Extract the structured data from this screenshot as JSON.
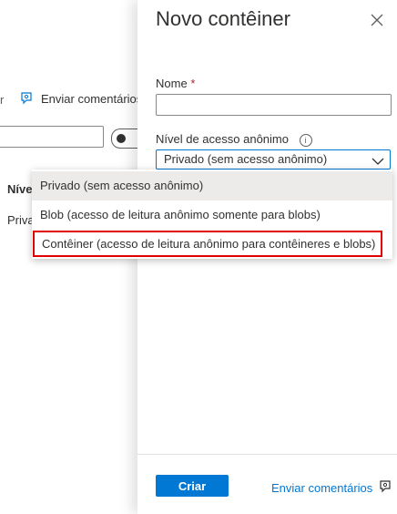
{
  "background": {
    "truncated_left": "r",
    "feedback_label": "Enviar comentários",
    "column_header": "Níve",
    "cell_value": "Priva"
  },
  "panel": {
    "title": "Novo contêiner",
    "name_label": "Nome",
    "required_mark": "*",
    "name_value": "",
    "access_label": "Nível de acesso anônimo",
    "info_glyph": "i",
    "access_selected": "Privado (sem acesso anônimo)",
    "dropdown_options": [
      "Privado (sem acesso anônimo)",
      "Blob (acesso de leitura anônimo somente para blobs)",
      "Contêiner (acesso de leitura anônimo para contêineres e blobs)"
    ],
    "create_button": "Criar",
    "feedback_label": "Enviar comentários"
  },
  "colors": {
    "accent": "#0078d4",
    "highlight_border": "#e00000",
    "required": "#a4262c",
    "selected_option_bg": "#edebe9"
  }
}
